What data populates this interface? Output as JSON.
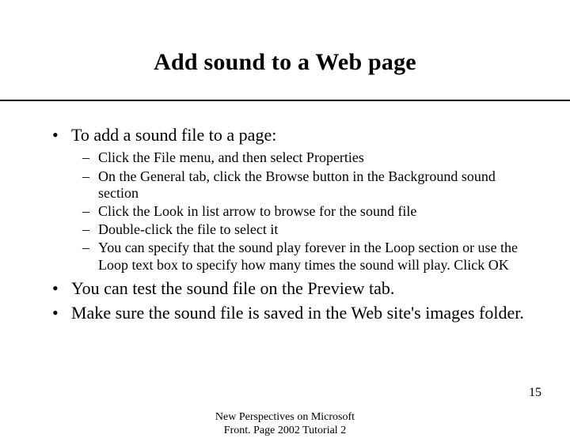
{
  "title": "Add sound to a Web page",
  "bullets": [
    {
      "text": "To add a sound file to a page:",
      "sub": [
        "Click the File menu, and then select Properties",
        "On the General tab, click the Browse button in the Background sound section",
        "Click the Look in list arrow to browse for the sound file",
        "Double-click the file to select it",
        "You can specify that the sound play forever in the Loop section or use the Loop text box to specify how many times the sound will play. Click OK"
      ]
    },
    {
      "text": "You can test the sound file on the Preview tab."
    },
    {
      "text": "Make sure the sound file is saved in the Web site's images folder."
    }
  ],
  "footer": {
    "line1": "New Perspectives on Microsoft",
    "line2": "Front. Page 2002 Tutorial 2",
    "page": "15"
  }
}
